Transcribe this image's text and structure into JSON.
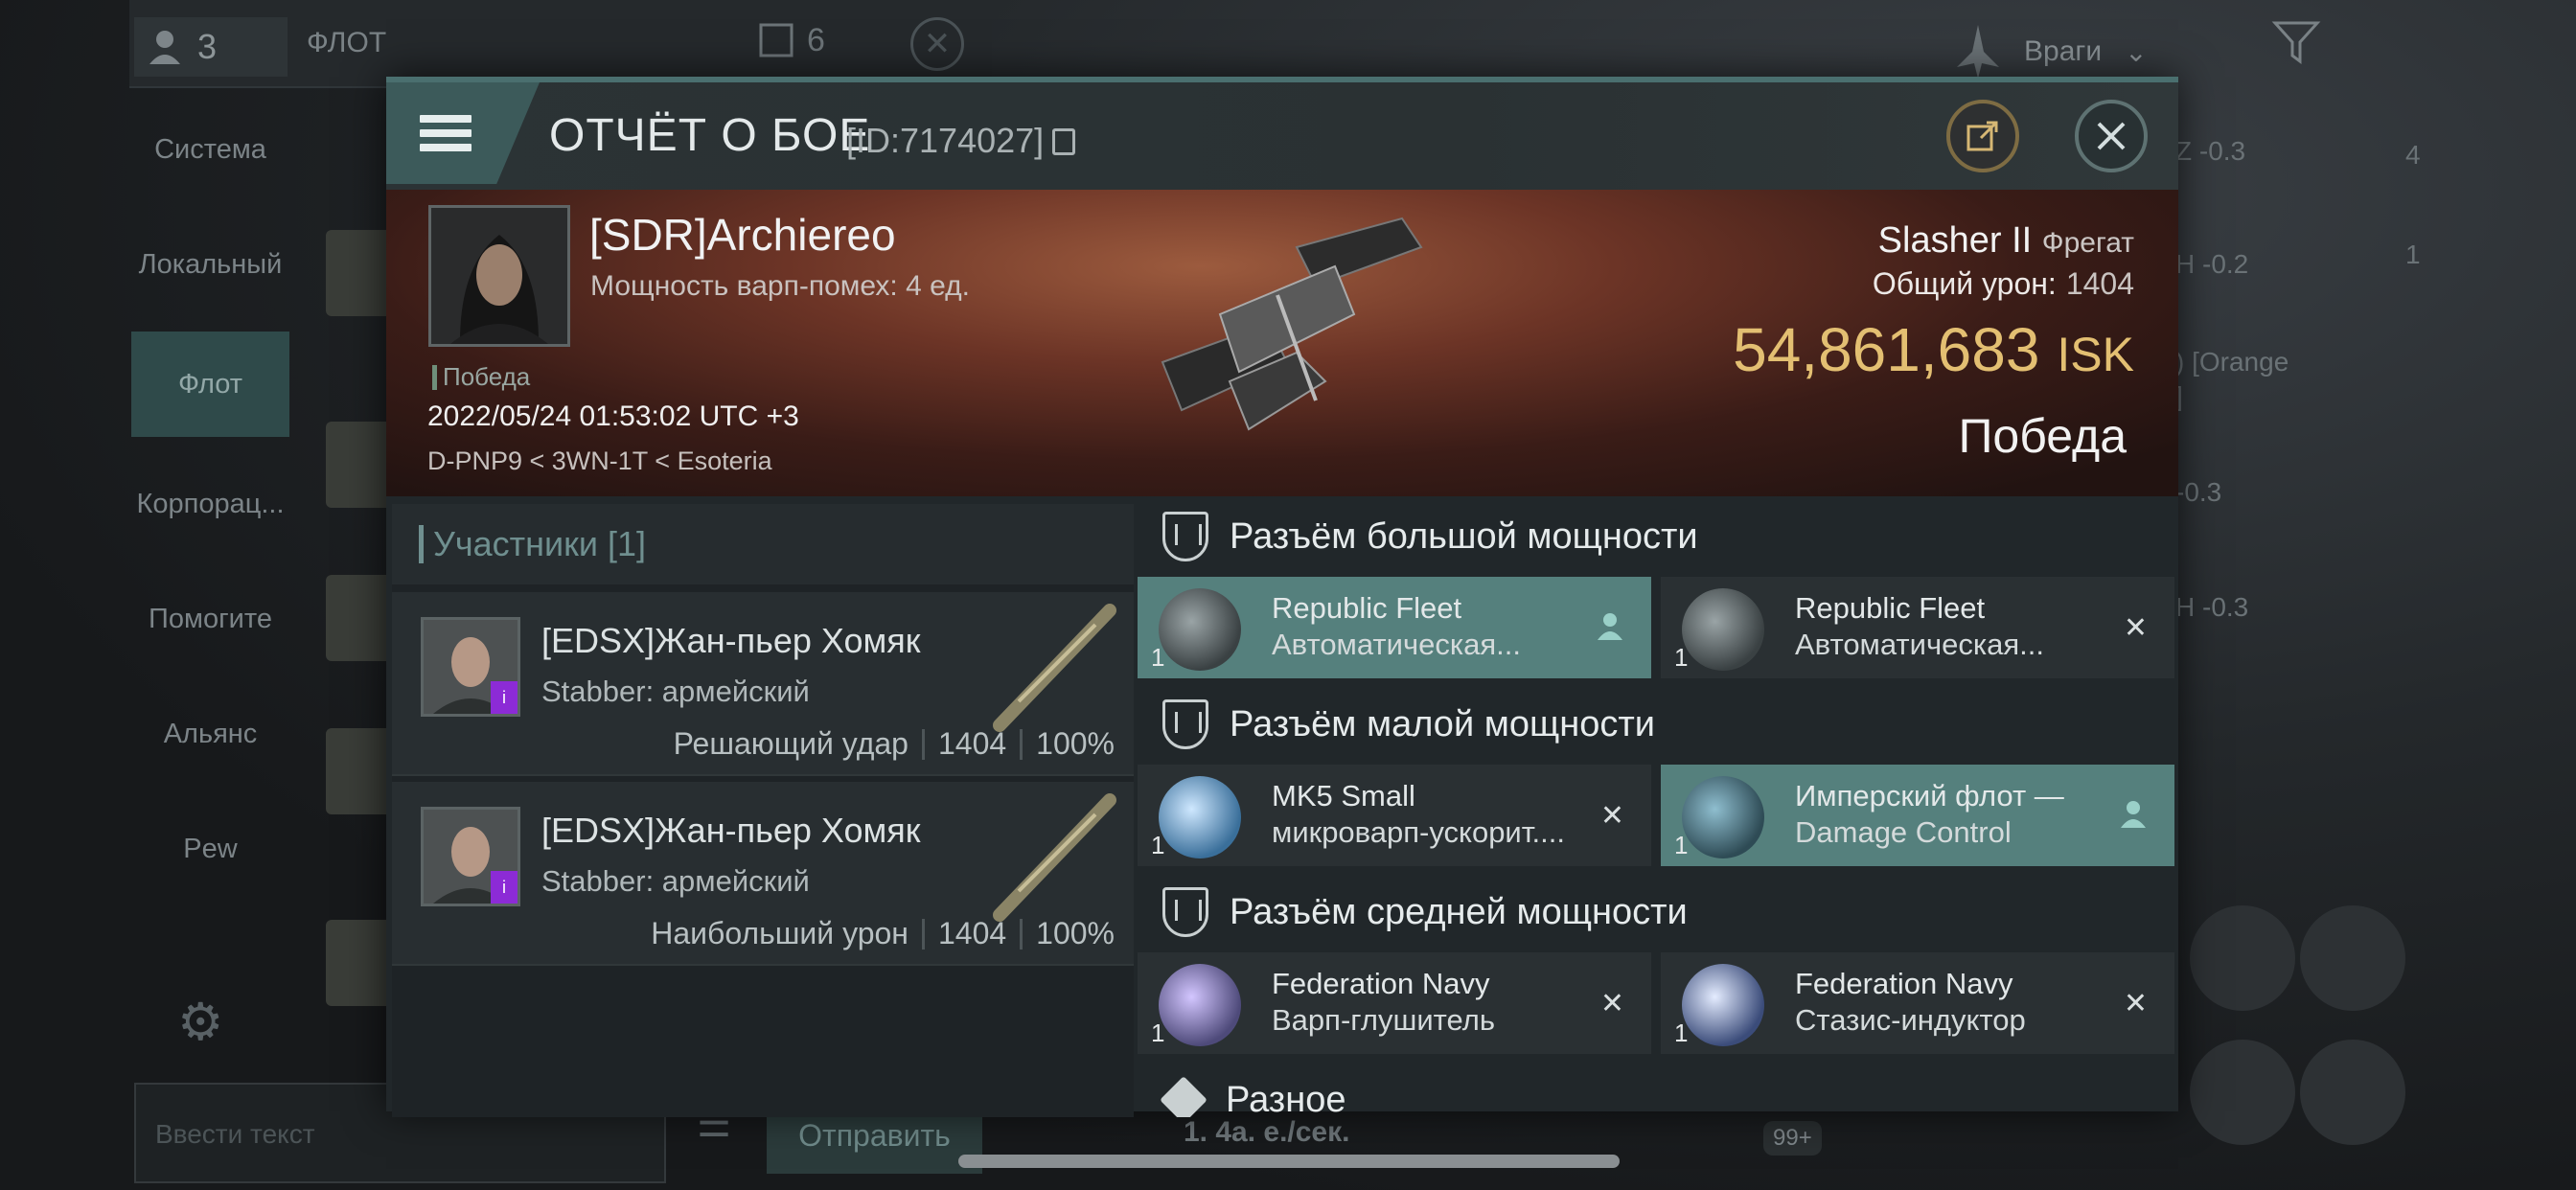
{
  "background": {
    "member_count": "3",
    "fleet_label": "ФЛОТ",
    "fleet_count": "6",
    "enemies_label": "Враги",
    "tabs": [
      "Система",
      "Локальный",
      "Флот",
      "Корпорац...",
      "Помогите",
      "Альянс",
      "Pew"
    ],
    "active_tab": "Флот",
    "input_placeholder": "Ввести текст",
    "send_label": "Отправить",
    "rate_text": "1.  4а. е./сек.",
    "badge_99": "99+",
    "right_list": [
      "Z -0.3",
      "H -0.2",
      ") [Orange",
      "]",
      "-0.3",
      "H -0.3"
    ],
    "right_counts": [
      "4",
      "1"
    ]
  },
  "modal": {
    "title": "ОТЧЁТ О БОЕ",
    "id_text": "[ID:7174027]",
    "hero": {
      "pilot_name": "[SDR]Archiereo",
      "warp_strength": "Мощность варп-помех: 4 ед.",
      "result_small": "Победа",
      "datetime": "2022/05/24 01:53:02 UTC +3",
      "route": "D-PNP9 < 3WN-1T < Esoteria",
      "ship_name": "Slasher II",
      "ship_class": "Фрегат",
      "damage_label": "Общий урон:",
      "damage_value": "1404",
      "isk_value": "54,861,683",
      "isk_unit": "ISK",
      "result_big": "Победа"
    },
    "participants": {
      "header": "Участники [1]",
      "rows": [
        {
          "name": "[EDSX]Жан-пьер Хомяк",
          "ship": "Stabber: армейский",
          "role": "Решающий удар",
          "damage": "1404",
          "percent": "100%"
        },
        {
          "name": "[EDSX]Жан-пьер Хомяк",
          "ship": "Stabber: армейский",
          "role": "Наибольший урон",
          "damage": "1404",
          "percent": "100%"
        }
      ]
    },
    "fitting": {
      "high_label": "Разъём большой мощности",
      "high": [
        {
          "line1": "Republic Fleet",
          "line2": "Автоматическая...",
          "qty": "1",
          "status": "pilot",
          "highlight": true
        },
        {
          "line1": "Republic Fleet",
          "line2": "Автоматическая...",
          "qty": "1",
          "status": "destroyed",
          "highlight": false
        }
      ],
      "low_label": "Разъём малой мощности",
      "low": [
        {
          "line1": "MK5 Small",
          "line2": "микроварп-ускорит....",
          "qty": "1",
          "status": "destroyed",
          "highlight": false
        },
        {
          "line1": "Имперский флот —",
          "line2": "Damage Control",
          "qty": "1",
          "status": "pilot",
          "highlight": true
        }
      ],
      "mid_label": "Разъём средней мощности",
      "mid": [
        {
          "line1": "Federation Navy",
          "line2": "Варп-глушитель",
          "qty": "1",
          "status": "destroyed",
          "highlight": false
        },
        {
          "line1": "Federation Navy",
          "line2": "Стазис-индуктор",
          "qty": "1",
          "status": "destroyed",
          "highlight": false
        }
      ],
      "misc_label": "Разное"
    }
  },
  "icons": {
    "destroyed": "✕",
    "pilot": "person-icon"
  }
}
